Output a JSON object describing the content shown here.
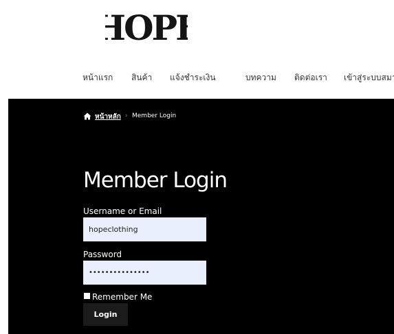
{
  "logo": {
    "text": "HOPE"
  },
  "nav": {
    "items": [
      {
        "label": "หน้าแรก"
      },
      {
        "label": "สินค้า"
      },
      {
        "label": "แจ้งชำระเงิน",
        "icon": "chevron-down-icon"
      },
      {
        "label": "บทความ"
      },
      {
        "label": "ติดต่อเรา"
      },
      {
        "label": "เข้าสู่ระบบสมา"
      }
    ]
  },
  "breadcrumb": {
    "home_label": "หน้าหลัก",
    "separator": "›",
    "current": "Member Login"
  },
  "page": {
    "title": "Member Login"
  },
  "form": {
    "username_label": "Username or Email",
    "username_value": "hopeclothing",
    "password_label": "Password",
    "password_value": "•••••••••••••••",
    "remember_label": "Remember Me",
    "remember_checked": true,
    "submit_label": "Login"
  },
  "colors": {
    "background": "#ffffff",
    "panel": "#000000",
    "input_bg": "#e9effd",
    "button_bg": "#1b1b1b",
    "text_light": "#ffffff",
    "nav_text": "#333333"
  }
}
